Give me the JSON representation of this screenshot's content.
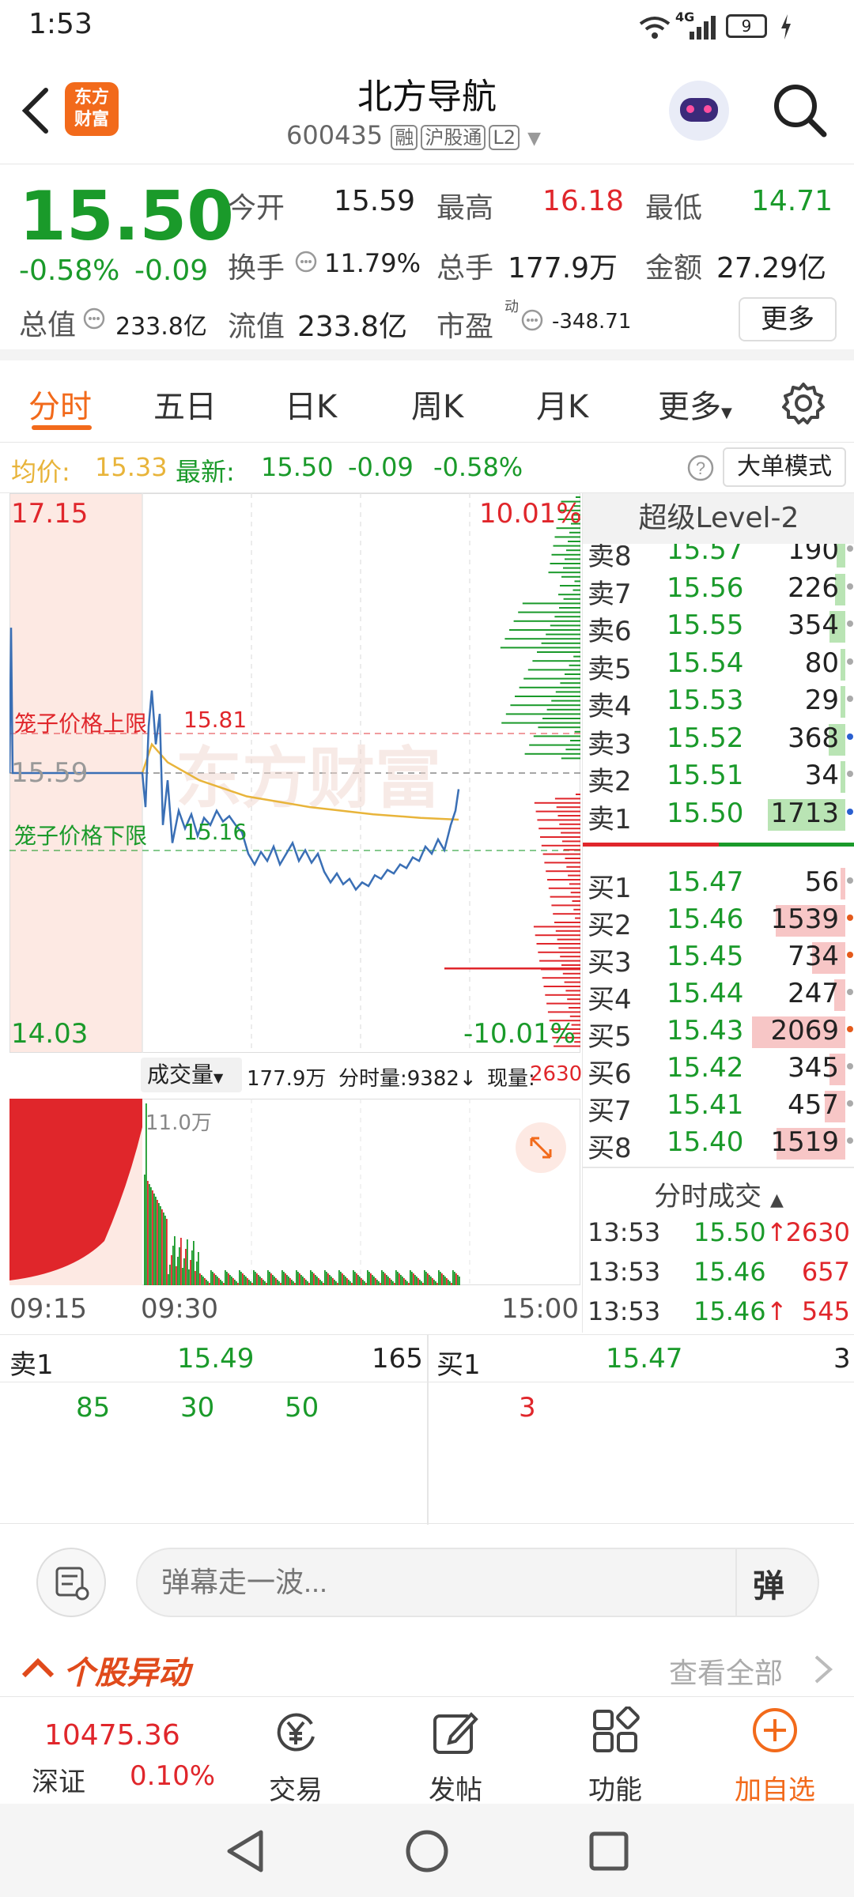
{
  "status_bar": {
    "time": "1:53",
    "network": "4G",
    "battery": "9"
  },
  "header": {
    "logo_line1": "东方",
    "logo_line2": "财富",
    "stock_name": "北方导航",
    "stock_code": "600435",
    "tags": [
      "融",
      "沪股通",
      "L2"
    ]
  },
  "quote": {
    "price": "15.50",
    "change_pct": "-0.58%",
    "change": "-0.09",
    "open_label": "今开",
    "open": "15.59",
    "high_label": "最高",
    "high": "16.18",
    "low_label": "最低",
    "low": "14.71",
    "turnover_label": "换手",
    "turnover": "11.79%",
    "total_vol_label": "总手",
    "total_vol": "177.9万",
    "amount_label": "金额",
    "amount": "27.29亿",
    "total_mv_label": "总值",
    "total_mv": "233.8亿",
    "float_mv_label": "流值",
    "float_mv": "233.8亿",
    "pe_label": "市盈",
    "pe_sup": "动",
    "pe": "-348.71",
    "more_label": "更多"
  },
  "tabs": [
    "分时",
    "五日",
    "日K",
    "周K",
    "月K",
    "更多"
  ],
  "avg_bar": {
    "avg_label": "均价:",
    "avg": "15.33",
    "latest_label": "最新:",
    "latest": "15.50",
    "chg": "-0.09",
    "chg_pct": "-0.58%",
    "bigorder_label": "大单模式"
  },
  "chart": {
    "top_price": "17.15",
    "top_pct": "10.01%",
    "bottom_price": "14.03",
    "bottom_pct": "-10.01%",
    "ref_price": "15.59",
    "upper_limit_label": "笼子价格上限",
    "upper_limit": "15.81",
    "lower_limit_label": "笼子价格下限",
    "lower_limit": "15.16",
    "watermark": "东方财富",
    "colors": {
      "price": "#3a6fb5",
      "avg": "#e8b43a"
    }
  },
  "volume": {
    "selector_label": "成交量",
    "total": "177.9万",
    "minute_vol": "分时量:9382↓",
    "now_label": "现量:",
    "now": "2630",
    "max_label": "11.0万"
  },
  "time_axis": [
    "09:15",
    "09:30",
    "15:00"
  ],
  "level2": {
    "title": "超级Level-2",
    "asks": [
      {
        "label": "卖8",
        "price": "15.57",
        "vol": "190"
      },
      {
        "label": "卖7",
        "price": "15.56",
        "vol": "226"
      },
      {
        "label": "卖6",
        "price": "15.55",
        "vol": "354"
      },
      {
        "label": "卖5",
        "price": "15.54",
        "vol": "80"
      },
      {
        "label": "卖4",
        "price": "15.53",
        "vol": "29"
      },
      {
        "label": "卖3",
        "price": "15.52",
        "vol": "368"
      },
      {
        "label": "卖2",
        "price": "15.51",
        "vol": "34"
      },
      {
        "label": "卖1",
        "price": "15.50",
        "vol": "1713"
      }
    ],
    "bids": [
      {
        "label": "买1",
        "price": "15.47",
        "vol": "56"
      },
      {
        "label": "买2",
        "price": "15.46",
        "vol": "1539"
      },
      {
        "label": "买3",
        "price": "15.45",
        "vol": "734"
      },
      {
        "label": "买4",
        "price": "15.44",
        "vol": "247"
      },
      {
        "label": "买5",
        "price": "15.43",
        "vol": "2069"
      },
      {
        "label": "买6",
        "price": "15.42",
        "vol": "345"
      },
      {
        "label": "买7",
        "price": "15.41",
        "vol": "457"
      },
      {
        "label": "买8",
        "price": "15.40",
        "vol": "1519"
      }
    ],
    "ticks_title": "分时成交",
    "ticks": [
      {
        "time": "13:53",
        "price": "15.50",
        "vol": "2630",
        "arrow": "↑"
      },
      {
        "time": "13:53",
        "price": "15.46",
        "vol": "657",
        "arrow": ""
      },
      {
        "time": "13:53",
        "price": "15.46",
        "vol": "545",
        "arrow": "↑"
      }
    ]
  },
  "queue": {
    "sell_label": "卖1",
    "sell_price": "15.49",
    "sell_total": "165",
    "sell_orders": [
      "85",
      "30",
      "50"
    ],
    "buy_label": "买1",
    "buy_price": "15.47",
    "buy_total": "3",
    "buy_orders": [
      "3"
    ]
  },
  "danmu": {
    "placeholder": "弹幕走一波...",
    "send_label": "弹"
  },
  "anomaly": {
    "title": "个股异动",
    "view_all": "查看全部"
  },
  "bottom_nav": {
    "index_value": "10475.36",
    "index_name": "深证",
    "index_pct": "0.10%",
    "items": [
      "交易",
      "发帖",
      "功能",
      "加自选"
    ]
  }
}
